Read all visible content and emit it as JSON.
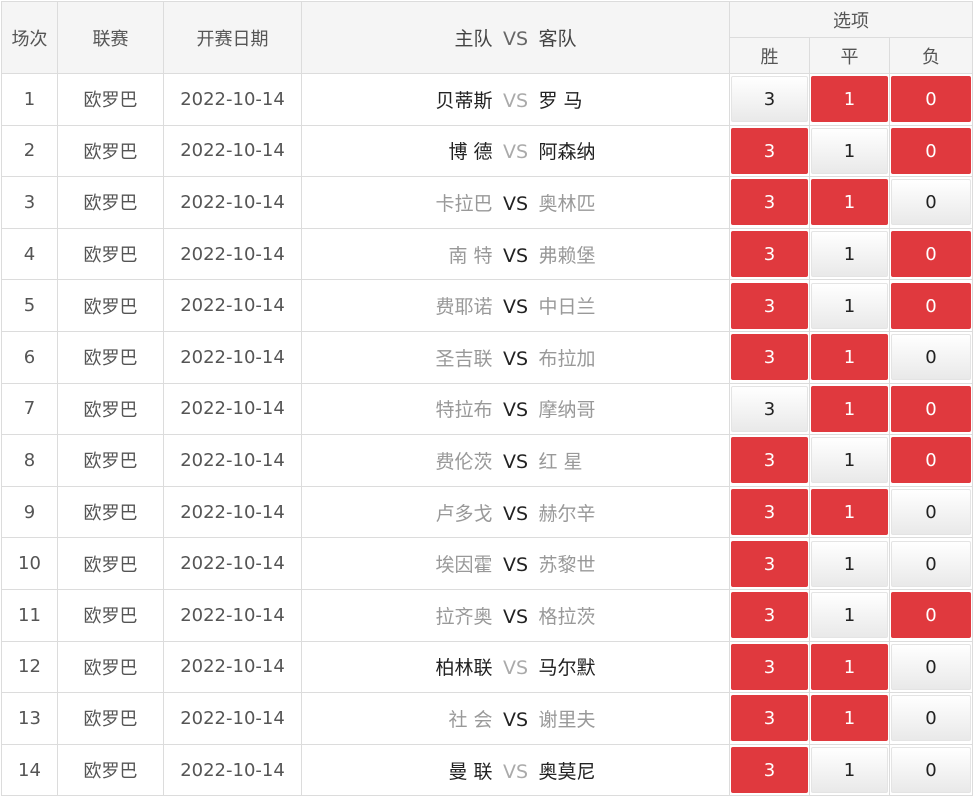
{
  "header": {
    "index": "场次",
    "league": "联赛",
    "date": "开赛日期",
    "home": "主队",
    "vs": "VS",
    "away": "客队",
    "options": "选项",
    "win": "胜",
    "draw": "平",
    "lose": "负"
  },
  "colors": {
    "selected": "#e0393e",
    "unselected": "#f0f0f0"
  },
  "matches": [
    {
      "no": "1",
      "league": "欧罗巴",
      "date": "2022-10-14",
      "home": "贝蒂斯",
      "away": "罗 马",
      "team_color": "dark",
      "vs_color": "light",
      "opts": [
        "3",
        "1",
        "0"
      ],
      "sel": [
        false,
        true,
        true
      ]
    },
    {
      "no": "2",
      "league": "欧罗巴",
      "date": "2022-10-14",
      "home": "博 德",
      "away": "阿森纳",
      "team_color": "dark",
      "vs_color": "light",
      "opts": [
        "3",
        "1",
        "0"
      ],
      "sel": [
        true,
        false,
        true
      ]
    },
    {
      "no": "3",
      "league": "欧罗巴",
      "date": "2022-10-14",
      "home": "卡拉巴",
      "away": "奥林匹",
      "team_color": "light",
      "vs_color": "dark",
      "opts": [
        "3",
        "1",
        "0"
      ],
      "sel": [
        true,
        true,
        false
      ]
    },
    {
      "no": "4",
      "league": "欧罗巴",
      "date": "2022-10-14",
      "home": "南 特",
      "away": "弗赖堡",
      "team_color": "light",
      "vs_color": "dark",
      "opts": [
        "3",
        "1",
        "0"
      ],
      "sel": [
        true,
        false,
        true
      ]
    },
    {
      "no": "5",
      "league": "欧罗巴",
      "date": "2022-10-14",
      "home": "费耶诺",
      "away": "中日兰",
      "team_color": "light",
      "vs_color": "dark",
      "opts": [
        "3",
        "1",
        "0"
      ],
      "sel": [
        true,
        false,
        true
      ]
    },
    {
      "no": "6",
      "league": "欧罗巴",
      "date": "2022-10-14",
      "home": "圣吉联",
      "away": "布拉加",
      "team_color": "light",
      "vs_color": "dark",
      "opts": [
        "3",
        "1",
        "0"
      ],
      "sel": [
        true,
        true,
        false
      ]
    },
    {
      "no": "7",
      "league": "欧罗巴",
      "date": "2022-10-14",
      "home": "特拉布",
      "away": "摩纳哥",
      "team_color": "light",
      "vs_color": "dark",
      "opts": [
        "3",
        "1",
        "0"
      ],
      "sel": [
        false,
        true,
        true
      ]
    },
    {
      "no": "8",
      "league": "欧罗巴",
      "date": "2022-10-14",
      "home": "费伦茨",
      "away": "红 星",
      "team_color": "light",
      "vs_color": "dark",
      "opts": [
        "3",
        "1",
        "0"
      ],
      "sel": [
        true,
        false,
        true
      ]
    },
    {
      "no": "9",
      "league": "欧罗巴",
      "date": "2022-10-14",
      "home": "卢多戈",
      "away": "赫尔辛",
      "team_color": "light",
      "vs_color": "dark",
      "opts": [
        "3",
        "1",
        "0"
      ],
      "sel": [
        true,
        true,
        false
      ]
    },
    {
      "no": "10",
      "league": "欧罗巴",
      "date": "2022-10-14",
      "home": "埃因霍",
      "away": "苏黎世",
      "team_color": "light",
      "vs_color": "dark",
      "opts": [
        "3",
        "1",
        "0"
      ],
      "sel": [
        true,
        false,
        false
      ]
    },
    {
      "no": "11",
      "league": "欧罗巴",
      "date": "2022-10-14",
      "home": "拉齐奥",
      "away": "格拉茨",
      "team_color": "light",
      "vs_color": "dark",
      "opts": [
        "3",
        "1",
        "0"
      ],
      "sel": [
        true,
        false,
        true
      ]
    },
    {
      "no": "12",
      "league": "欧罗巴",
      "date": "2022-10-14",
      "home": "柏林联",
      "away": "马尔默",
      "team_color": "dark",
      "vs_color": "light",
      "opts": [
        "3",
        "1",
        "0"
      ],
      "sel": [
        true,
        true,
        false
      ]
    },
    {
      "no": "13",
      "league": "欧罗巴",
      "date": "2022-10-14",
      "home": "社 会",
      "away": "谢里夫",
      "team_color": "light",
      "vs_color": "dark",
      "opts": [
        "3",
        "1",
        "0"
      ],
      "sel": [
        true,
        true,
        false
      ]
    },
    {
      "no": "14",
      "league": "欧罗巴",
      "date": "2022-10-14",
      "home": "曼 联",
      "away": "奥莫尼",
      "team_color": "dark",
      "vs_color": "light",
      "opts": [
        "3",
        "1",
        "0"
      ],
      "sel": [
        true,
        false,
        false
      ]
    }
  ]
}
